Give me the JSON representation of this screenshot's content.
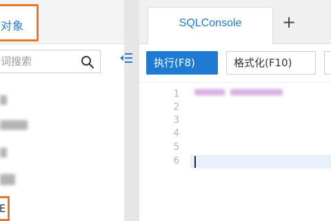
{
  "left_panel": {
    "tab_label": "对象",
    "search": {
      "placeholder": "词搜索"
    },
    "tree_item_partial": "E"
  },
  "tabs": [
    {
      "label": "SQLConsole"
    }
  ],
  "add_tab_label": "+",
  "toolbar": {
    "run_label": "执行(F8)",
    "format_label": "格式化(F10)"
  },
  "editor": {
    "line_numbers": [
      "1",
      "2",
      "3",
      "4",
      "5",
      "6"
    ]
  },
  "colors": {
    "accent": "#1f7ad1",
    "highlight_box": "#e8772a"
  }
}
